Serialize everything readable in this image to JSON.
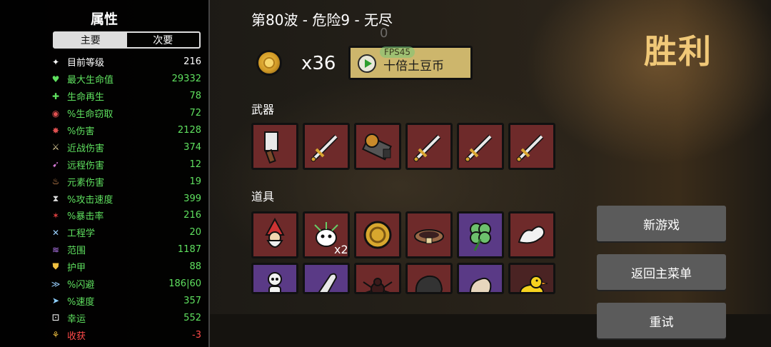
{
  "stats_panel": {
    "title": "属性",
    "tabs": [
      {
        "label": "主要",
        "active": true
      },
      {
        "label": "次要",
        "active": false
      }
    ],
    "stats": [
      {
        "label": "目前等级",
        "value": "216",
        "color": "#ffffff",
        "icon": "level-icon"
      },
      {
        "label": "最大生命值",
        "value": "29332",
        "color": "#5fe05f",
        "icon": "heart-icon"
      },
      {
        "label": "生命再生",
        "value": "78",
        "color": "#5fe05f",
        "icon": "regen-icon"
      },
      {
        "label": "%生命窃取",
        "value": "72",
        "color": "#5fe05f",
        "icon": "lifesteal-icon"
      },
      {
        "label": "%伤害",
        "value": "2128",
        "color": "#5fe05f",
        "icon": "damage-icon"
      },
      {
        "label": "近战伤害",
        "value": "374",
        "color": "#5fe05f",
        "icon": "sword-icon"
      },
      {
        "label": "远程伤害",
        "value": "12",
        "color": "#5fe05f",
        "icon": "bow-icon"
      },
      {
        "label": "元素伤害",
        "value": "19",
        "color": "#5fe05f",
        "icon": "flame-icon"
      },
      {
        "label": "%攻击速度",
        "value": "399",
        "color": "#5fe05f",
        "icon": "hourglass-icon"
      },
      {
        "label": "%暴击率",
        "value": "216",
        "color": "#5fe05f",
        "icon": "crit-icon"
      },
      {
        "label": "工程学",
        "value": "20",
        "color": "#5fe05f",
        "icon": "wrench-icon"
      },
      {
        "label": "范围",
        "value": "1187",
        "color": "#5fe05f",
        "icon": "range-icon"
      },
      {
        "label": "护甲",
        "value": "88",
        "color": "#5fe05f",
        "icon": "shield-icon"
      },
      {
        "label": "%闪避",
        "value": "186|60",
        "color": "#5fe05f",
        "icon": "dodge-icon"
      },
      {
        "label": "%速度",
        "value": "357",
        "color": "#5fe05f",
        "icon": "speed-icon"
      },
      {
        "label": "幸运",
        "value": "552",
        "color": "#5fe05f",
        "icon": "dice-icon"
      },
      {
        "label": "收获",
        "value": "-3",
        "color": "#ff4a4a",
        "icon": "harvest-icon"
      }
    ]
  },
  "header": {
    "wave_title": "第80波 - 危险9 - 无尽",
    "ghost_counter": "0",
    "coin_count": "x36",
    "ten_potato_button": "十倍土豆币",
    "fps_badge": "FPS45",
    "victory": "胜利"
  },
  "weapons": {
    "label": "武器",
    "items": [
      {
        "name": "cleaver-icon"
      },
      {
        "name": "sword-icon"
      },
      {
        "name": "gatling-icon"
      },
      {
        "name": "sword-icon"
      },
      {
        "name": "sword-icon"
      },
      {
        "name": "sword-icon"
      }
    ]
  },
  "items": {
    "label": "道具",
    "quantity_label": "x2",
    "items": [
      {
        "name": "gnome-icon",
        "tier": "red"
      },
      {
        "name": "baby-alien-icon",
        "tier": "red"
      },
      {
        "name": "coin-icon",
        "tier": "red"
      },
      {
        "name": "belt-icon",
        "tier": "red"
      },
      {
        "name": "clover-icon",
        "tier": "purple"
      },
      {
        "name": "muscle-arm-icon",
        "tier": "red"
      },
      {
        "name": "skeleton-icon",
        "tier": "purple"
      },
      {
        "name": "bullet-icon",
        "tier": "purple"
      },
      {
        "name": "spider-icon",
        "tier": "red"
      },
      {
        "name": "rock-icon",
        "tier": "red"
      },
      {
        "name": "bird-icon",
        "tier": "purple"
      },
      {
        "name": "duck-icon",
        "tier": "dark"
      }
    ]
  },
  "menu": {
    "new_game": "新游戏",
    "main_menu": "返回主菜单",
    "retry": "重试"
  }
}
